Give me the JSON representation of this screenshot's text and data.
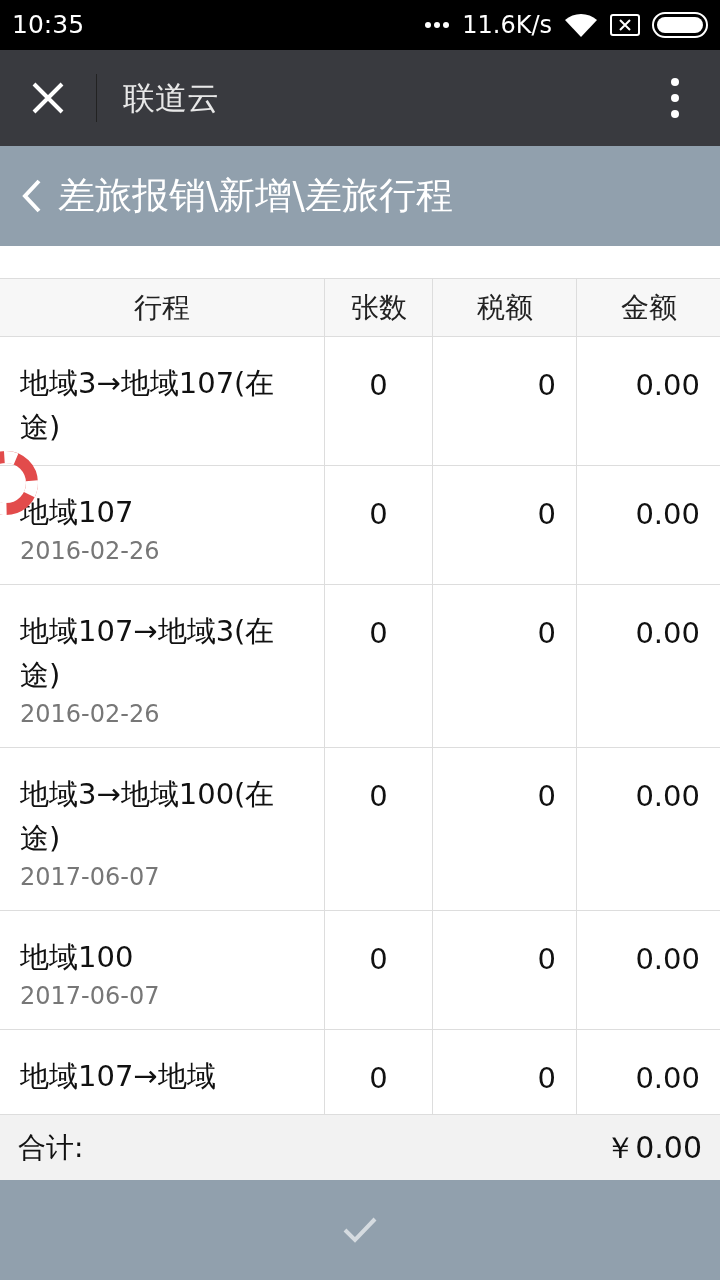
{
  "status_bar": {
    "time": "10:35",
    "network_speed": "11.6K/s"
  },
  "app_bar": {
    "title": "联道云"
  },
  "page_header": {
    "title": "差旅报销\\新增\\差旅行程"
  },
  "table": {
    "columns": [
      "行程",
      "张数",
      "税额",
      "金额"
    ],
    "rows": [
      {
        "route": "地域3→地域107(在途)",
        "count": "0",
        "tax": "0",
        "amount": "0.00"
      },
      {
        "route": "地域107",
        "date": "2016-02-26",
        "count": "0",
        "tax": "0",
        "amount": "0.00"
      },
      {
        "route": "地域107→地域3(在途)",
        "date": "2016-02-26",
        "count": "0",
        "tax": "0",
        "amount": "0.00"
      },
      {
        "route": "地域3→地域100(在途)",
        "date": "2017-06-07",
        "count": "0",
        "tax": "0",
        "amount": "0.00"
      },
      {
        "route": "地域100",
        "date": "2017-06-07",
        "count": "0",
        "tax": "0",
        "amount": "0.00"
      },
      {
        "route": "地域107→地域",
        "count": "0",
        "tax": "0",
        "amount": "0.00"
      }
    ]
  },
  "total": {
    "label": "合计:",
    "value": "￥0.00"
  }
}
